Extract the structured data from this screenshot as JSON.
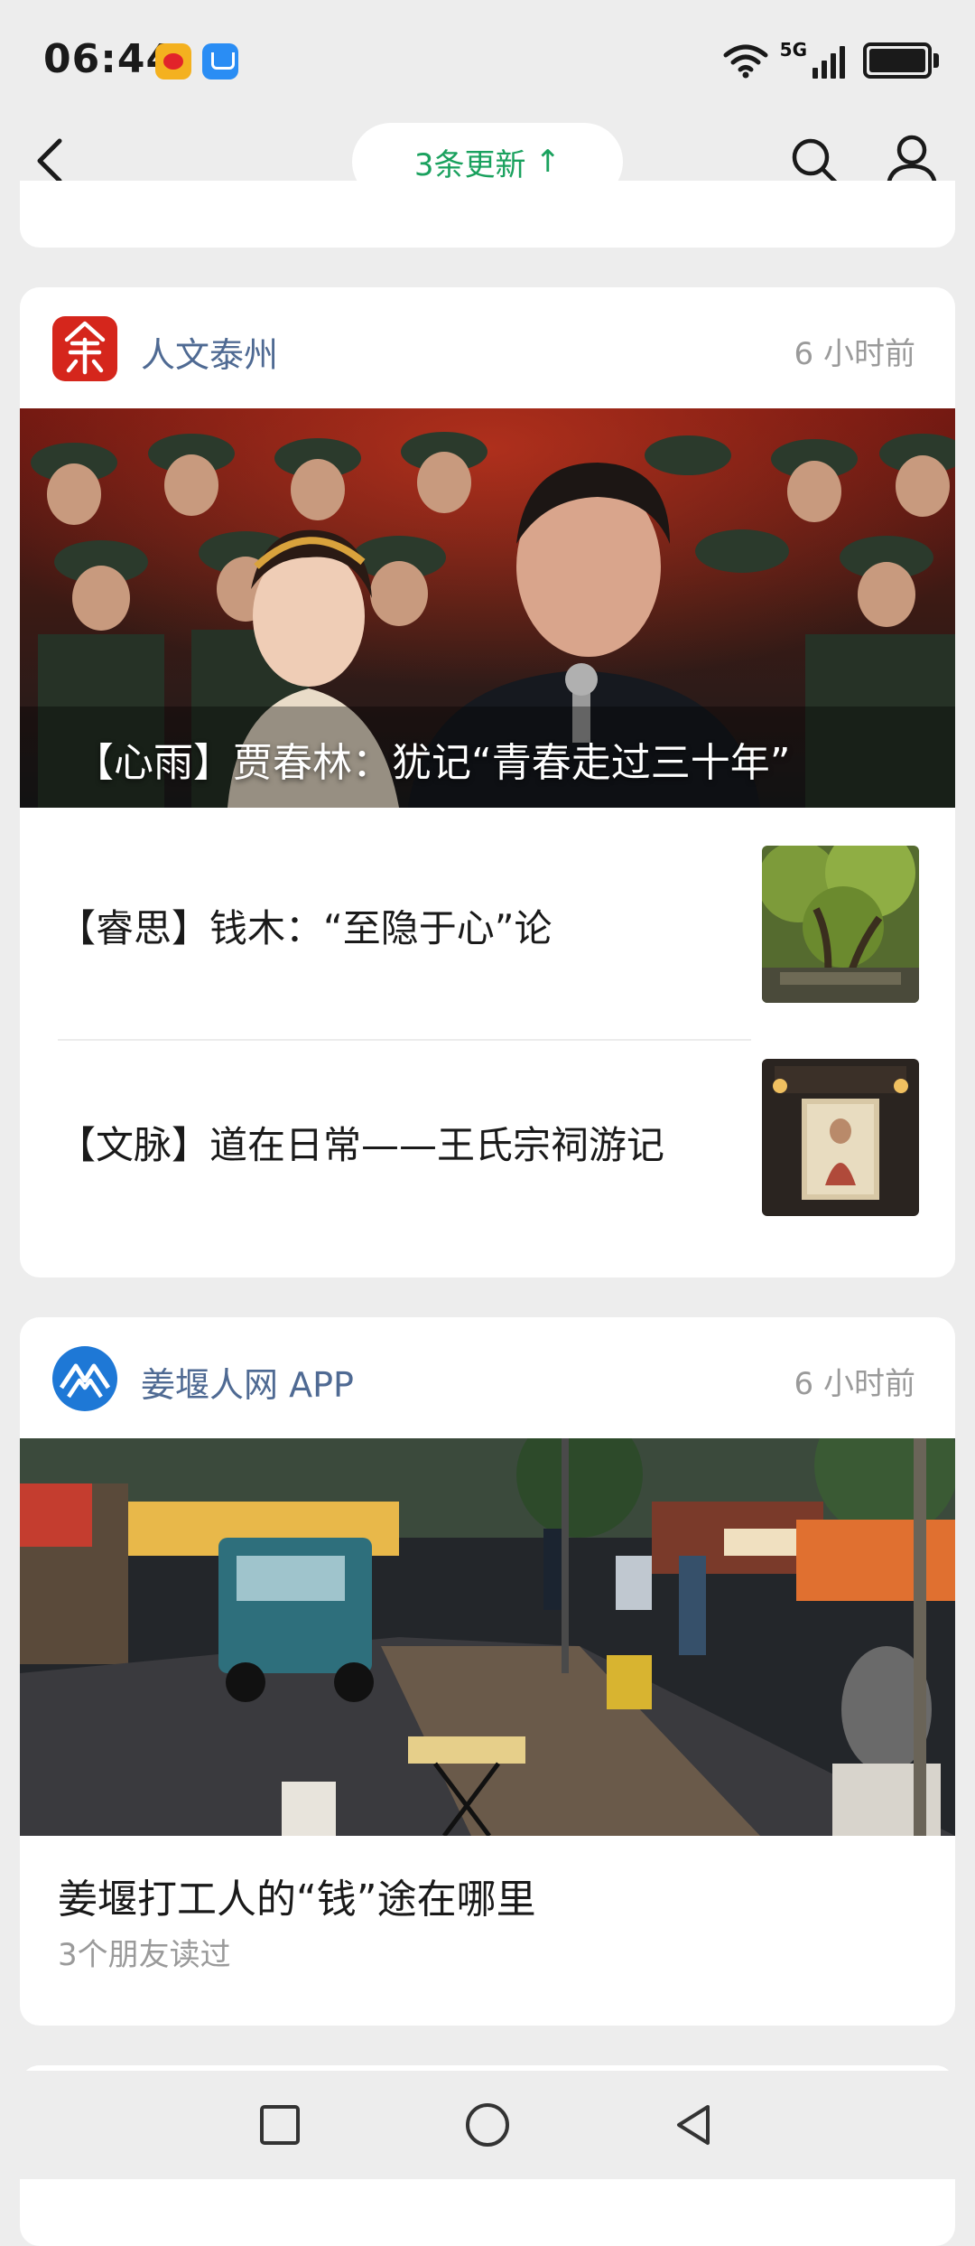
{
  "status": {
    "time": "06:44",
    "network": "5G",
    "app_icons": [
      "weibo-icon",
      "honor-store-icon"
    ]
  },
  "header": {
    "update_label": "3条更新",
    "update_arrow": "↑",
    "icons": [
      "back-chevron-icon",
      "search-icon",
      "user-icon"
    ]
  },
  "feed": [
    {
      "source": "人文泰州",
      "time_ago": "6 小时前",
      "hero_title": "【心雨】贾春林：犹记“青春走过三十年”",
      "items": [
        {
          "title": "【睿思】钱木：“至隐于心”论"
        },
        {
          "title": "【文脉】道在日常——王氏宗祠游记"
        }
      ]
    },
    {
      "source": "姜堰人网 APP",
      "time_ago": "6 小时前",
      "headline": "姜堰打工人的“钱”途在哪里",
      "read_by": "3个朋友读过"
    }
  ],
  "colors": {
    "accent_green": "#1aa15e",
    "source_blue": "#4f6a93",
    "muted": "#9a9a9a",
    "background": "#ededed"
  },
  "navbar": {
    "icons": [
      "recent-apps-icon",
      "home-icon",
      "back-triangle-icon"
    ]
  }
}
